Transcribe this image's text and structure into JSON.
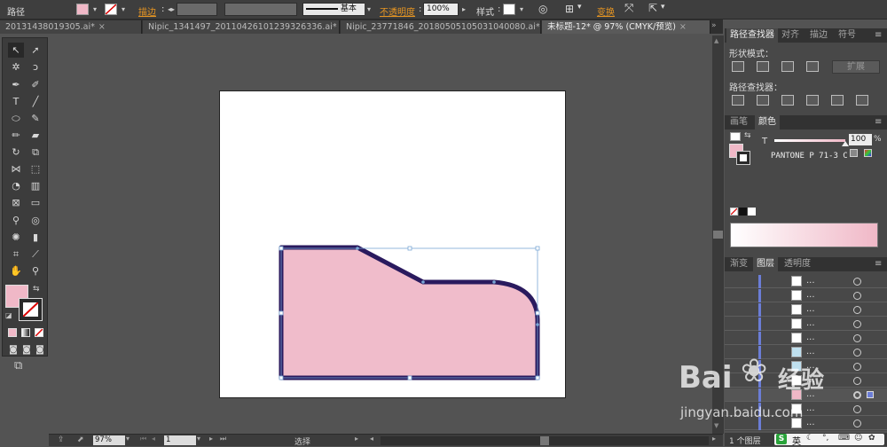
{
  "control_bar": {
    "object_label": "路径",
    "stroke_label": "描边",
    "stroke_style": "基本",
    "opacity_label": "不透明度",
    "opacity_value": "100%",
    "style_label": "样式",
    "transform_label": "变换"
  },
  "tabs": [
    {
      "label": "20131438019305.ai*",
      "active": false
    },
    {
      "label": "Nipic_1341497_20110426101239326336.ai*",
      "active": false
    },
    {
      "label": "Nipic_23771846_20180505105031040080.ai*",
      "active": false
    },
    {
      "label": "未标题-12* @ 97% (CMYK/预览)",
      "active": true
    }
  ],
  "pathfinder_panel": {
    "tabs": [
      "路径查找器",
      "对齐",
      "描边",
      "符号"
    ],
    "shape_modes_label": "形状模式：",
    "expand_label": "扩展",
    "pathfinders_label": "路径查找器："
  },
  "color_panel": {
    "tabs": [
      "画笔",
      "颜色"
    ],
    "tint_label": "T",
    "tint_value": "100",
    "tint_unit": "%",
    "swatch_name": "PANTONE P 71-3 C",
    "fill_color": "#f0b8c7"
  },
  "layers_panel": {
    "tabs": [
      "渐变",
      "图层",
      "透明度"
    ],
    "row_label": "...",
    "footer_label": "1 个图层"
  },
  "status_bar": {
    "zoom": "97%",
    "page": "1",
    "tool": "选择"
  },
  "artwork": {
    "fill": "#f0bccb",
    "stroke": "#2a1a5e"
  },
  "watermark": {
    "text": "Bai",
    "text2": "经验",
    "url": "jingyan.baidu.com"
  },
  "taskbar": {
    "ime_label": "英"
  }
}
